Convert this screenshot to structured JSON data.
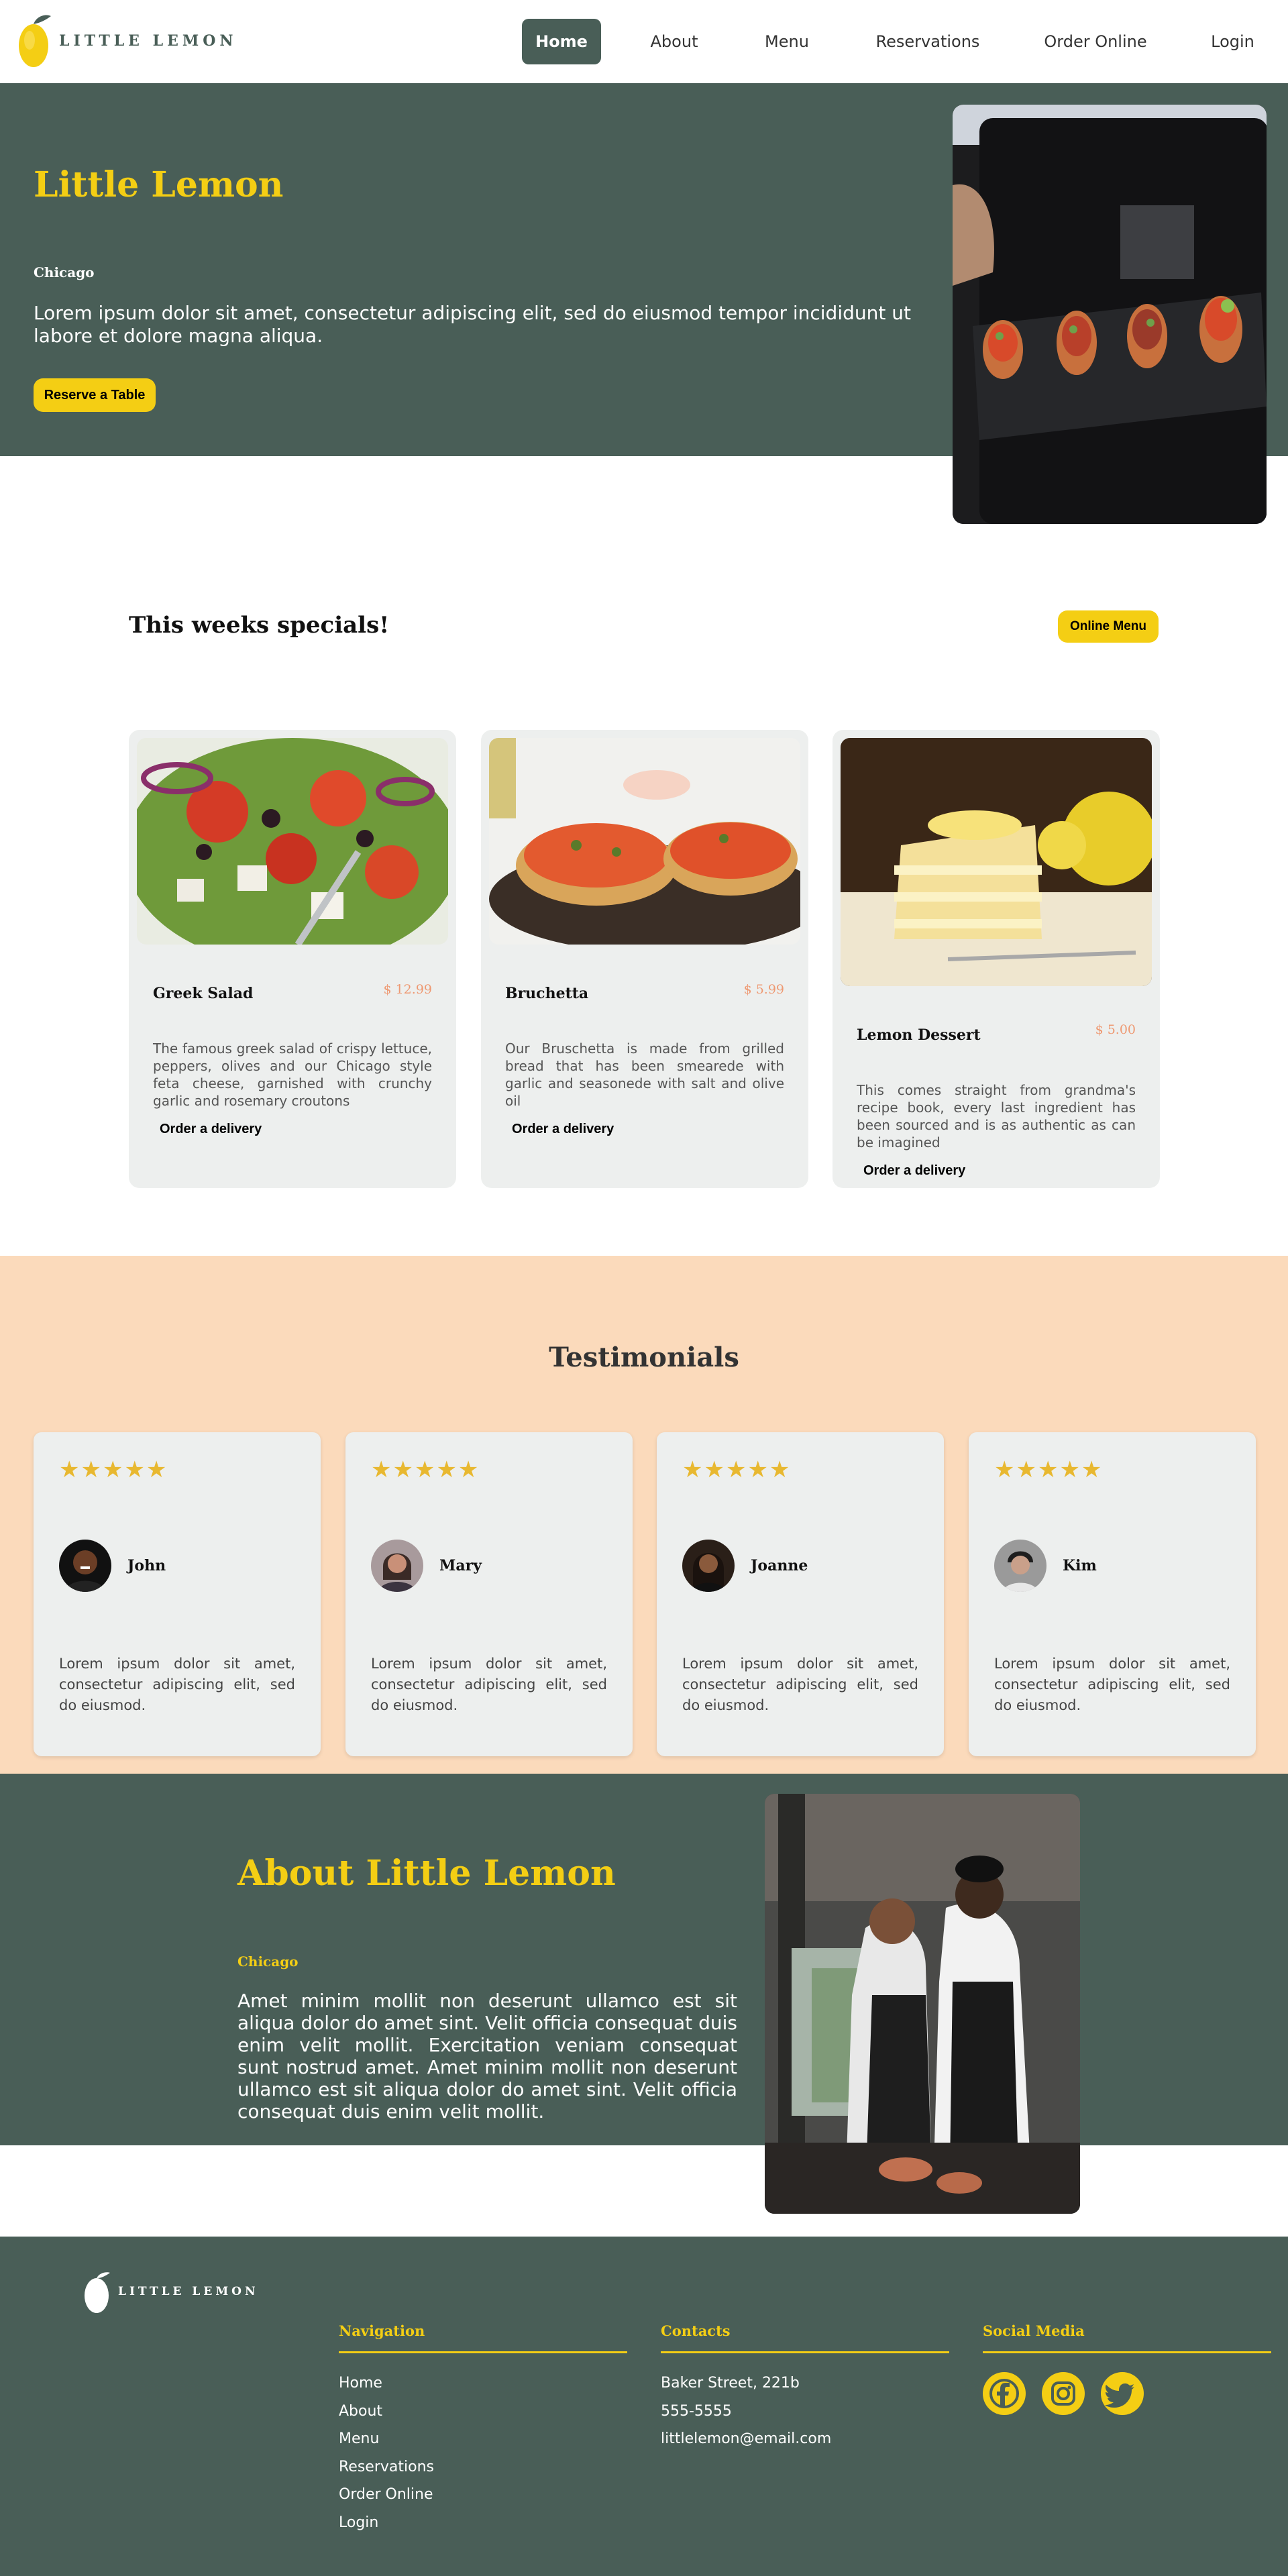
{
  "nav": {
    "logo_text": "LITTLE LEMON",
    "links": [
      {
        "label": "Home",
        "active": true
      },
      {
        "label": "About",
        "active": false
      },
      {
        "label": "Menu",
        "active": false
      },
      {
        "label": "Reservations",
        "active": false
      },
      {
        "label": "Order Online",
        "active": false
      },
      {
        "label": "Login",
        "active": false
      }
    ]
  },
  "hero": {
    "title": "Little Lemon",
    "subtitle": "Chicago",
    "description": "Lorem ipsum dolor sit amet, consectetur adipiscing elit, sed do eiusmod tempor incididunt ut labore et dolore magna aliqua.",
    "button_label": "Reserve a Table"
  },
  "specials": {
    "title": "This weeks specials!",
    "button_label": "Online Menu",
    "cards": [
      {
        "name": "Greek Salad",
        "price": "$ 12.99",
        "description": "The famous greek salad of crispy lettuce, peppers, olives and our Chicago style feta cheese, garnished with crunchy garlic and rosemary croutons",
        "order_label": "Order a delivery"
      },
      {
        "name": "Bruchetta",
        "price": "$ 5.99",
        "description": "Our Bruschetta is made from grilled bread that has been smearede with garlic and seasonede with salt and olive oil",
        "order_label": "Order a delivery"
      },
      {
        "name": "Lemon Dessert",
        "price": "$ 5.00",
        "description": "This comes straight from grandma's recipe book, every last ingredient has been sourced and is as authentic as can be imagined",
        "order_label": "Order a delivery"
      }
    ]
  },
  "testimonials": {
    "title": "Testimonials",
    "items": [
      {
        "name": "John",
        "rating": 5,
        "stars": "★★★★★",
        "quote": "Lorem ipsum dolor sit amet, consectetur adipiscing elit, sed do eiusmod."
      },
      {
        "name": "Mary",
        "rating": 5,
        "stars": "★★★★★",
        "quote": "Lorem ipsum dolor sit amet, consectetur adipiscing elit, sed do eiusmod."
      },
      {
        "name": "Joanne",
        "rating": 5,
        "stars": "★★★★★",
        "quote": "Lorem ipsum dolor sit amet, consectetur adipiscing elit, sed do eiusmod."
      },
      {
        "name": "Kim",
        "rating": 5,
        "stars": "★★★★★",
        "quote": "Lorem ipsum dolor sit amet, consectetur adipiscing elit, sed do eiusmod."
      }
    ]
  },
  "about": {
    "title": "About Little Lemon",
    "subtitle": "Chicago",
    "description": "Amet minim mollit non deserunt ullamco est sit aliqua dolor do amet sint. Velit officia consequat duis enim velit mollit. Exercitation veniam consequat sunt nostrud amet. Amet minim mollit non deserunt ullamco est sit aliqua dolor do amet sint. Velit officia consequat duis enim velit mollit."
  },
  "footer": {
    "logo_text": "LITTLE LEMON",
    "navigation": {
      "title": "Navigation",
      "links": [
        "Home",
        "About",
        "Menu",
        "Reservations",
        "Order Online",
        "Login"
      ]
    },
    "contacts": {
      "title": "Contacts",
      "lines": [
        "Baker Street, 221b",
        "555-5555",
        "littlelemon@email.com"
      ]
    },
    "social": {
      "title": "Social Media",
      "icons": [
        "facebook-icon",
        "instagram-icon",
        "twitter-icon"
      ]
    }
  },
  "colors": {
    "primary_green": "#495E57",
    "primary_yellow": "#F4CE14",
    "peach": "#FBDABB",
    "card_gray": "#EDEFEE",
    "price_orange": "#EE9972"
  }
}
